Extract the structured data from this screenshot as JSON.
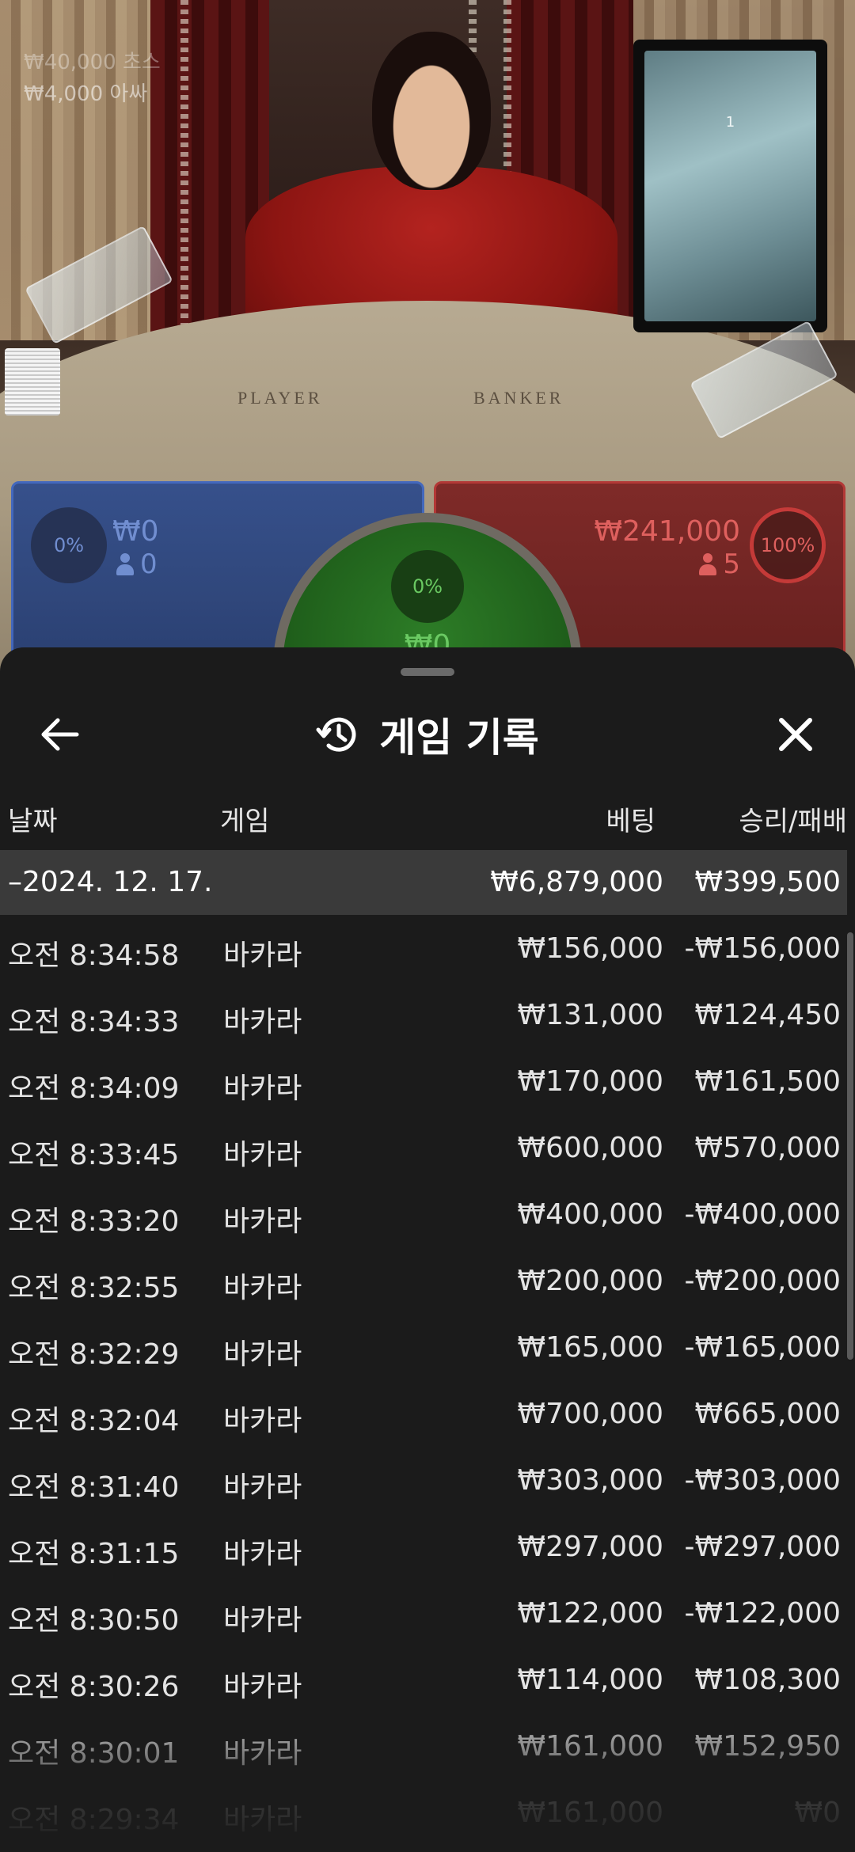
{
  "video": {
    "limit_line_1": "₩40,000 초스",
    "limit_line_2": "₩4,000 아싸",
    "felt_player": "PLAYER",
    "felt_banker": "BANKER",
    "monitor_number": "1"
  },
  "bets": {
    "player": {
      "percent": "0%",
      "amount": "₩0",
      "count": "0",
      "color": "#6d8ed8"
    },
    "tie": {
      "percent": "0%",
      "amount": "₩0",
      "color": "#6ac962"
    },
    "banker": {
      "percent": "100%",
      "amount": "₩241,000",
      "count": "5",
      "color": "#e45c5c"
    }
  },
  "sheet": {
    "title": "게임 기록",
    "back_icon": "arrow-left-icon",
    "history_icon": "history-icon",
    "close_icon": "close-icon",
    "columns": {
      "date": "날짜",
      "game": "게임",
      "bet": "베팅",
      "result": "승리/패배"
    },
    "summary": {
      "date": "–2024. 12. 17.",
      "bet": "₩6,879,000",
      "result": "₩399,500"
    },
    "rows": [
      {
        "time": "오전 8:34:58",
        "game": "바카라",
        "bet": "₩156,000",
        "result": "-₩156,000"
      },
      {
        "time": "오전 8:34:33",
        "game": "바카라",
        "bet": "₩131,000",
        "result": "₩124,450"
      },
      {
        "time": "오전 8:34:09",
        "game": "바카라",
        "bet": "₩170,000",
        "result": "₩161,500"
      },
      {
        "time": "오전 8:33:45",
        "game": "바카라",
        "bet": "₩600,000",
        "result": "₩570,000"
      },
      {
        "time": "오전 8:33:20",
        "game": "바카라",
        "bet": "₩400,000",
        "result": "-₩400,000"
      },
      {
        "time": "오전 8:32:55",
        "game": "바카라",
        "bet": "₩200,000",
        "result": "-₩200,000"
      },
      {
        "time": "오전 8:32:29",
        "game": "바카라",
        "bet": "₩165,000",
        "result": "-₩165,000"
      },
      {
        "time": "오전 8:32:04",
        "game": "바카라",
        "bet": "₩700,000",
        "result": "₩665,000"
      },
      {
        "time": "오전 8:31:40",
        "game": "바카라",
        "bet": "₩303,000",
        "result": "-₩303,000"
      },
      {
        "time": "오전 8:31:15",
        "game": "바카라",
        "bet": "₩297,000",
        "result": "-₩297,000"
      },
      {
        "time": "오전 8:30:50",
        "game": "바카라",
        "bet": "₩122,000",
        "result": "-₩122,000"
      },
      {
        "time": "오전 8:30:26",
        "game": "바카라",
        "bet": "₩114,000",
        "result": "₩108,300"
      },
      {
        "time": "오전 8:30:01",
        "game": "바카라",
        "bet": "₩161,000",
        "result": "₩152,950"
      },
      {
        "time": "오전 8:29:34",
        "game": "바카라",
        "bet": "₩161,000",
        "result": "₩0"
      }
    ]
  }
}
